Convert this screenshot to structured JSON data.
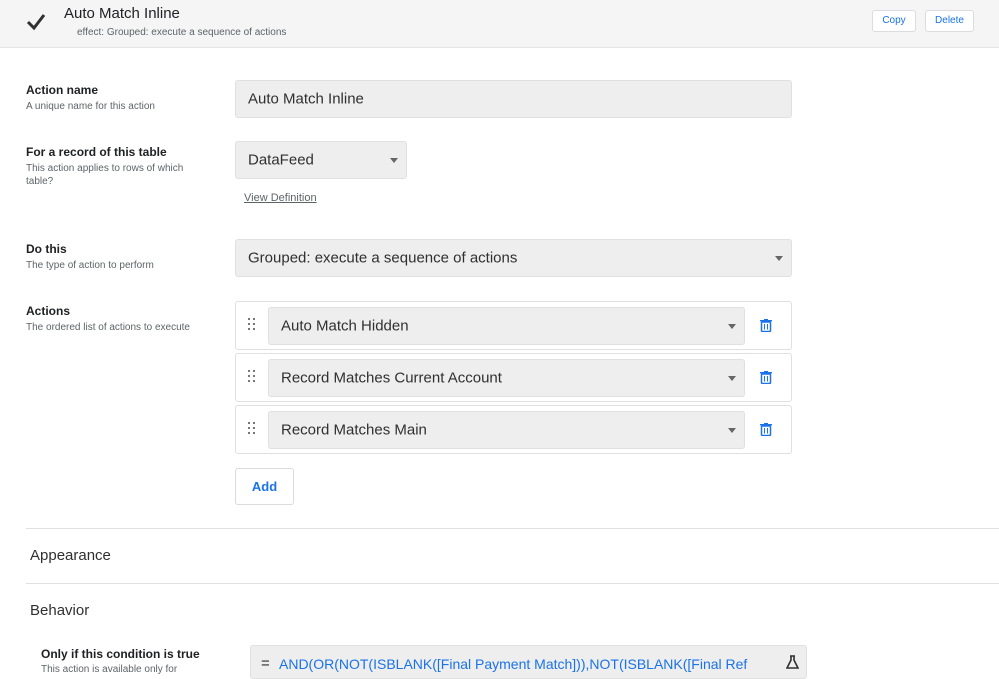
{
  "header": {
    "title": "Auto Match Inline",
    "subtitle": "effect: Grouped: execute a sequence of actions",
    "copy_label": "Copy",
    "delete_label": "Delete"
  },
  "form": {
    "action_name": {
      "label": "Action name",
      "description": "A unique name for this action",
      "value": "Auto Match Inline"
    },
    "table": {
      "label": "For a record of this table",
      "description": "This action applies to rows of which table?",
      "value": "DataFeed",
      "link": "View Definition"
    },
    "do_this": {
      "label": "Do this",
      "description": "The type of action to perform",
      "value": "Grouped: execute a sequence of actions"
    },
    "actions": {
      "label": "Actions",
      "description": "The ordered list of actions to execute",
      "items": [
        "Auto Match Hidden",
        "Record Matches Current Account",
        "Record Matches Main"
      ],
      "add_label": "Add"
    }
  },
  "sections": {
    "appearance": "Appearance",
    "behavior": "Behavior"
  },
  "condition": {
    "label": "Only if this condition is true",
    "description": "This action is available only for",
    "equals": "=",
    "expression": "AND(OR(NOT(ISBLANK([Final Payment Match])),NOT(ISBLANK([Final Ref"
  },
  "colors": {
    "accent": "#1a73e8",
    "field_bg": "#eeeeee",
    "header_bg": "#f5f5f5"
  },
  "icons": {
    "check": "check-icon",
    "drag": "drag-handle-icon",
    "trash": "trash-icon",
    "flask": "flask-icon"
  }
}
